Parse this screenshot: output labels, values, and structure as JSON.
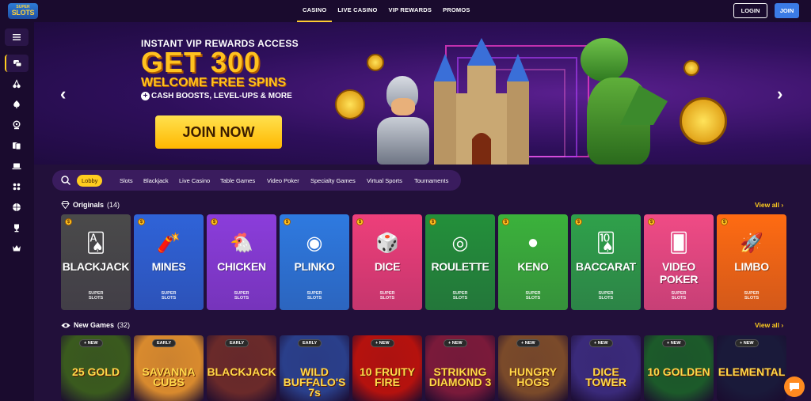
{
  "logo": {
    "top": "SUPER",
    "bottom": "SLOTS"
  },
  "nav": {
    "items": [
      "CASINO",
      "LIVE CASINO",
      "VIP REWARDS",
      "PROMOS"
    ],
    "active": "CASINO"
  },
  "auth": {
    "login": "LOGIN",
    "join": "JOIN"
  },
  "sidebar": {
    "icons": [
      "menu-icon",
      "chat-bubbles-icon",
      "cherry-icon",
      "spade-icon",
      "roulette-icon",
      "cards-icon",
      "laptop-icon",
      "dice-icon",
      "basketball-icon",
      "trophy-icon",
      "crown-icon"
    ]
  },
  "hero": {
    "line1": "INSTANT VIP REWARDS ACCESS",
    "line2": "GET 300",
    "line3": "WELCOME FREE SPINS",
    "line4_prefix": "+",
    "line4": "CASH BOOSTS, LEVEL-UPS & MORE",
    "cta": "JOIN NOW",
    "prev": "‹",
    "next": "›"
  },
  "filters": [
    "Lobby",
    "Slots",
    "Blackjack",
    "Live Casino",
    "Table Games",
    "Video Poker",
    "Specialty Games",
    "Virtual Sports",
    "Tournaments"
  ],
  "originals": {
    "title": "Originals",
    "count": "(14)",
    "view_all": "View all ›",
    "cards": [
      {
        "name": "BLACKJACK",
        "color": "#4a4a4a",
        "art": "🂡"
      },
      {
        "name": "MINES",
        "color": "#2f63d8",
        "art": "🧨"
      },
      {
        "name": "CHICKEN",
        "color": "#8b3ddb",
        "art": "🐔"
      },
      {
        "name": "PLINKO",
        "color": "#2e7ae0",
        "art": "◉"
      },
      {
        "name": "DICE",
        "color": "#ee3f7a",
        "art": "🎲"
      },
      {
        "name": "ROULETTE",
        "color": "#23903a",
        "art": "◎"
      },
      {
        "name": "KENO",
        "color": "#3bb23b",
        "art": "●"
      },
      {
        "name": "BACCARAT",
        "color": "#2fa14a",
        "art": "🂪"
      },
      {
        "name": "VIDEO POKER",
        "color": "#f04b85",
        "art": "🂠"
      },
      {
        "name": "LIMBO",
        "color": "#ff6b12",
        "art": "🚀"
      }
    ],
    "brand_top": "SUPER",
    "brand_bottom": "SLOTS"
  },
  "new_games": {
    "title": "New Games",
    "count": "(32)",
    "view_all": "View all ›",
    "cards": [
      {
        "title": "25 GOLD",
        "badge": "+ NEW",
        "color": "#3a5a1e"
      },
      {
        "title": "SAVANNA CUBS",
        "badge": "EARLY",
        "color": "#d88a2e"
      },
      {
        "title": "BLACKJACK",
        "badge": "EARLY",
        "color": "#6a2a2a"
      },
      {
        "title": "WILD BUFFALO'S 7s",
        "badge": "EARLY",
        "color": "#2a3f8a"
      },
      {
        "title": "10 FRUITY FIRE",
        "badge": "+ NEW",
        "color": "#b5120e"
      },
      {
        "title": "STRIKING DIAMOND 3",
        "badge": "+ NEW",
        "color": "#7a1a3a"
      },
      {
        "title": "HUNGRY HOGS",
        "badge": "+ NEW",
        "color": "#7a4a2a"
      },
      {
        "title": "DICE TOWER",
        "badge": "+ NEW",
        "color": "#3a2a7a"
      },
      {
        "title": "10 GOLDEN",
        "badge": "+ NEW",
        "color": "#1c5a2a"
      },
      {
        "title": "ELEMENTAL",
        "badge": "+ NEW",
        "color": "#1a1a3a"
      }
    ]
  }
}
